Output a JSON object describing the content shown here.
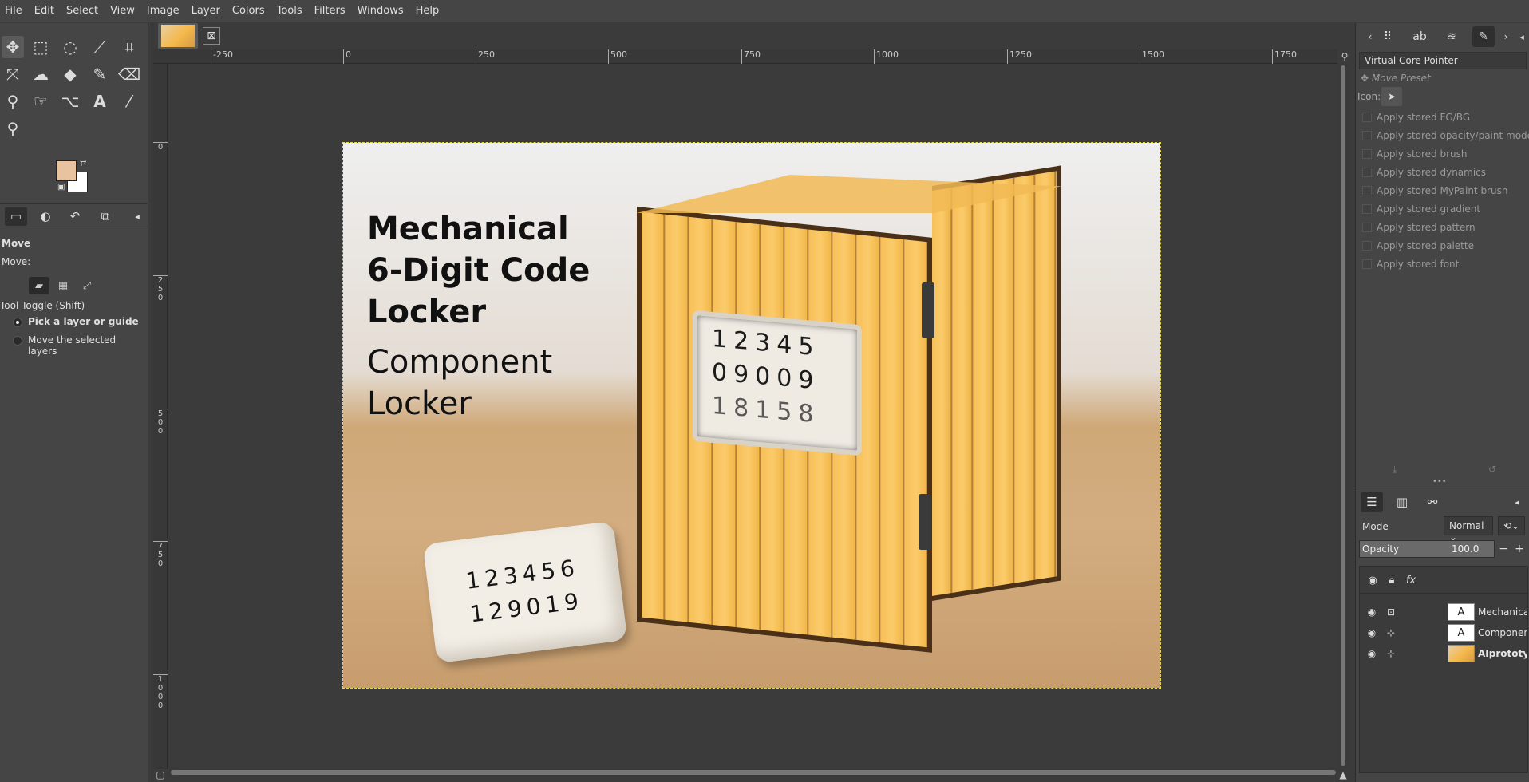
{
  "menubar": [
    "File",
    "Edit",
    "Select",
    "View",
    "Image",
    "Layer",
    "Colors",
    "Tools",
    "Filters",
    "Windows",
    "Help"
  ],
  "toolbox": {
    "tools": [
      "move-icon",
      "rect-select-icon",
      "lasso-icon",
      "fuzzy-select-icon",
      "crop-icon",
      "transform-icon",
      "warp-icon",
      "bucket-fill-icon",
      "paintbrush-icon",
      "eraser-icon",
      "clone-icon",
      "smudge-icon",
      "paths-icon",
      "text-icon",
      "color-picker-icon",
      "zoom-icon"
    ],
    "fg_color": "#e9c39f",
    "bg_color": "#ffffff"
  },
  "tool_options": {
    "tool_name": "Move",
    "move_label": "Move:",
    "toggle_label": "Tool Toggle  (Shift)",
    "option_pick": "Pick a layer or guide",
    "option_move_selected": "Move the selected layers"
  },
  "ruler": {
    "h_ticks": [
      "-250",
      "0",
      "250",
      "500",
      "750",
      "1000",
      "1250",
      "1500",
      "1750"
    ],
    "v_ticks": [
      "0",
      "2\n5\n0",
      "5\n0\n0",
      "7\n5\n0",
      "1\n0\n0\n0"
    ]
  },
  "canvas": {
    "title": "Mechanical\n6-Digit Code\nLocker",
    "subtitle": "Component\nLocker",
    "dial_rows": [
      "12345",
      "09009",
      "18158"
    ],
    "cube_rows": [
      "123456",
      "129019"
    ]
  },
  "device_status": {
    "device": "Virtual Core Pointer",
    "move_preset": "Move Preset",
    "icon_label": "Icon:",
    "options": [
      "Apply stored FG/BG",
      "Apply stored opacity/paint mode",
      "Apply stored brush",
      "Apply stored dynamics",
      "Apply stored MyPaint brush",
      "Apply stored gradient",
      "Apply stored pattern",
      "Apply stored palette",
      "Apply stored font"
    ]
  },
  "layers": {
    "mode_label": "Mode",
    "mode_value": "Normal",
    "opacity_label": "Opacity",
    "opacity_value": "100.0",
    "items": [
      {
        "name": "Mechanical",
        "type": "text"
      },
      {
        "name": "Component",
        "type": "text"
      },
      {
        "name": "AIprototype",
        "type": "image"
      }
    ]
  }
}
